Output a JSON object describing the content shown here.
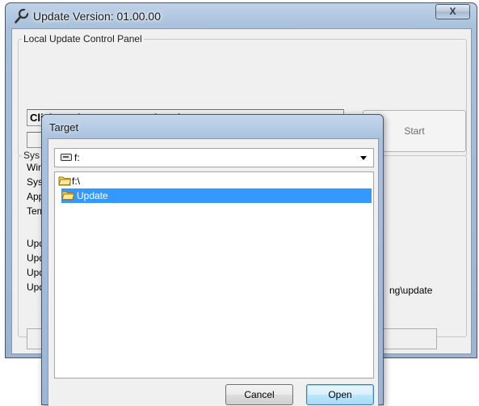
{
  "main_window": {
    "title": "Update Version: 01.00.00",
    "close_label": "X",
    "control_panel_label": "Local Update Control Panel",
    "status_text": "Click Begin to Start Local Update",
    "start_label": "Start",
    "system_group_label": "Sys",
    "system_rows": [
      "Win",
      "Syst",
      "App",
      "Tem",
      "Upd",
      "Upd",
      "Upd",
      "Upd"
    ],
    "path_fragment": "ng\\update"
  },
  "target_dialog": {
    "title": "Target",
    "drive_selected": "f:",
    "folders": [
      {
        "label": "f:\\",
        "selected": false
      },
      {
        "label": "Update",
        "selected": true
      }
    ],
    "cancel_label": "Cancel",
    "open_label": "Open"
  },
  "colors": {
    "selection": "#3399ff",
    "folder_yellow": "#f3d14f"
  }
}
